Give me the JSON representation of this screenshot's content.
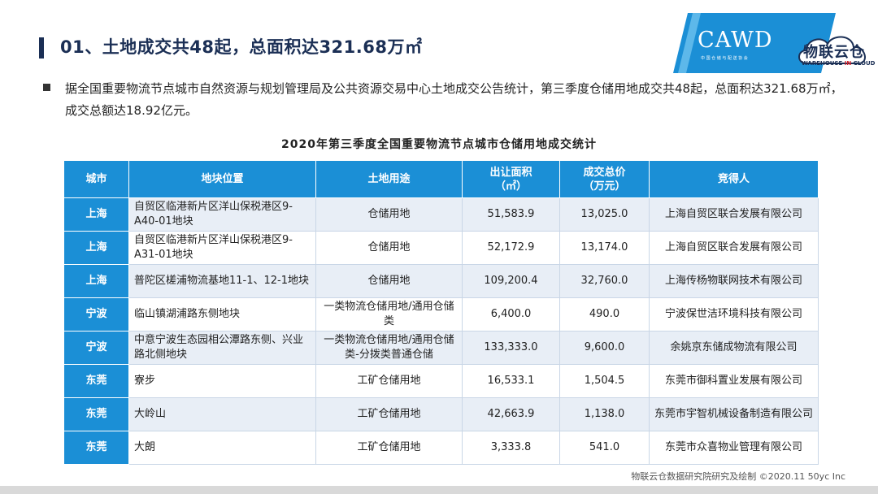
{
  "header": {
    "title": "01、土地成交共48起，总面积达321.68万㎡"
  },
  "logo": {
    "brand": "CAWD",
    "sub": "中 国 仓 储 与 配 送 协 会",
    "cloud_cn": "物联云仓",
    "cloud_en_a": "WAREHOUSE ",
    "cloud_en_b": "IN",
    "cloud_en_c": " CLOUD"
  },
  "intro": "据全国重要物流节点城市自然资源与规划管理局及公共资源交易中心土地成交公告统计，第三季度仓储用地成交共48起，总面积达321.68万㎡，成交总额达18.92亿元。",
  "table": {
    "title": "2020年第三季度全国重要物流节点城市仓储用地成交统计",
    "headers": {
      "city": "城市",
      "location": "地块位置",
      "use": "土地用途",
      "area_1": "出让面积",
      "area_2": "（㎡）",
      "price_1": "成交总价",
      "price_2": "（万元）",
      "winner": "竞得人"
    },
    "rows": [
      {
        "city": "上海",
        "location": "自贸区临港新片区洋山保税港区9-A40-01地块",
        "use": "仓储用地",
        "area": "51,583.9",
        "price": "13,025.0",
        "winner": "上海自贸区联合发展有限公司"
      },
      {
        "city": "上海",
        "location": "自贸区临港新片区洋山保税港区9-A31-01地块",
        "use": "仓储用地",
        "area": "52,172.9",
        "price": "13,174.0",
        "winner": "上海自贸区联合发展有限公司"
      },
      {
        "city": "上海",
        "location": "普陀区槎浦物流基地11-1、12-1地块",
        "use": "仓储用地",
        "area": "109,200.4",
        "price": "32,760.0",
        "winner": "上海传杨物联网技术有限公司"
      },
      {
        "city": "宁波",
        "location": "临山镇湖浦路东侧地块",
        "use": "一类物流仓储用地/通用仓储类",
        "area": "6,400.0",
        "price": "490.0",
        "winner": "宁波保世洁环境科技有限公司"
      },
      {
        "city": "宁波",
        "location": "中意宁波生态园相公潭路东侧、兴业路北侧地块",
        "use": "一类物流仓储用地/通用仓储类-分拨类普通仓储",
        "area": "133,333.0",
        "price": "9,600.0",
        "winner": "余姚京东储成物流有限公司"
      },
      {
        "city": "东莞",
        "location": "寮步",
        "use": "工矿仓储用地",
        "area": "16,533.1",
        "price": "1,504.5",
        "winner": "东莞市御科置业发展有限公司"
      },
      {
        "city": "东莞",
        "location": "大岭山",
        "use": "工矿仓储用地",
        "area": "42,663.9",
        "price": "1,138.0",
        "winner": "东莞市宇智机械设备制造有限公司"
      },
      {
        "city": "东莞",
        "location": "大朗",
        "use": "工矿仓储用地",
        "area": "3,333.8",
        "price": "541.0",
        "winner": "东莞市众喜物业管理有限公司"
      }
    ]
  },
  "footer": "物联云仓数据研究院研究及绘制   ©2020.11 50yc Inc",
  "colors": {
    "header_blue": "#1b8fd6",
    "title_navy": "#1b2f55",
    "row_tint": "#e8eef6"
  }
}
